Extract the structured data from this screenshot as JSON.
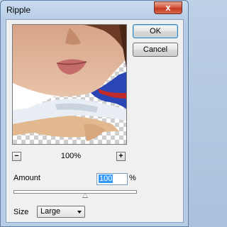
{
  "window": {
    "title": "Ripple",
    "close_glyph": "x"
  },
  "buttons": {
    "ok": "OK",
    "cancel": "Cancel"
  },
  "preview": {
    "zoom_out": "−",
    "zoom_in": "+",
    "zoom_level": "100%"
  },
  "amount": {
    "label": "Amount",
    "value": "100",
    "unit": "%",
    "slider_fraction": 0.58
  },
  "size": {
    "label": "Size",
    "selected": "Large"
  },
  "icons": {
    "close": "close-icon",
    "zoom_out": "zoom-out-icon",
    "zoom_in": "zoom-in-icon",
    "dropdown": "chevron-down-icon"
  }
}
